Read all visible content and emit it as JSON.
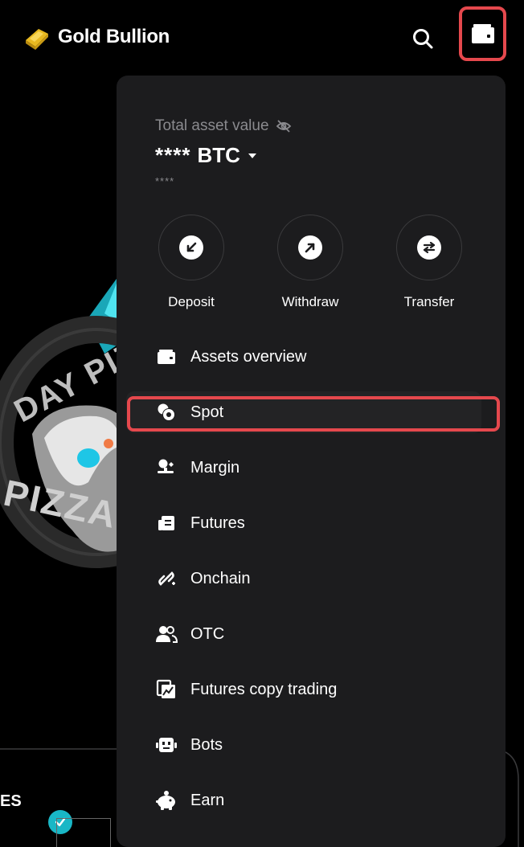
{
  "header": {
    "brand_name": "Gold Bullion"
  },
  "panel": {
    "total_asset_label": "Total asset value",
    "asset_mask": "****",
    "asset_currency": "BTC",
    "asset_sub_mask": "****",
    "actions": [
      {
        "label": "Deposit"
      },
      {
        "label": "Withdraw"
      },
      {
        "label": "Transfer"
      }
    ],
    "menu": [
      {
        "label": "Assets overview"
      },
      {
        "label": "Spot"
      },
      {
        "label": "Margin"
      },
      {
        "label": "Futures"
      },
      {
        "label": "Onchain"
      },
      {
        "label": "OTC"
      },
      {
        "label": "Futures copy trading"
      },
      {
        "label": "Bots"
      },
      {
        "label": "Earn"
      }
    ]
  },
  "background": {
    "promo_text_1": "DAY PIZZA",
    "promo_text_2": "PIZZA",
    "card_text": "ES"
  },
  "colors": {
    "highlight": "#e5484d",
    "panel_bg": "#1c1c1e",
    "page_bg": "#000000",
    "brand_gold": "#e8b920"
  }
}
